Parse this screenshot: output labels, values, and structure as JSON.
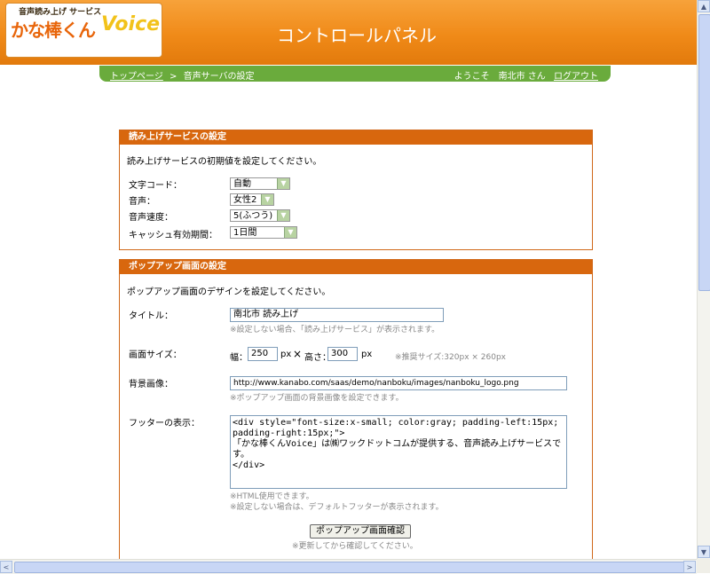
{
  "header": {
    "logo_top": "音声読み上げ サービス",
    "logo_main": "かな棒くん",
    "logo_voice": "Voice",
    "title": "コントロールパネル"
  },
  "nav": {
    "top_link": "トップページ",
    "separator": ">",
    "current": "音声サーバの設定",
    "welcome": "ようこそ　南北市 さん",
    "logout": "ログアウト"
  },
  "reading": {
    "title": "読み上げサービスの設定",
    "desc": "読み上げサービスの初期値を設定してください。",
    "fields": [
      {
        "label": "文字コード：",
        "value": "自動"
      },
      {
        "label": "音声：",
        "value": "女性2"
      },
      {
        "label": "音声速度：",
        "value": "5(ふつう)"
      },
      {
        "label": "キャッシュ有効期間：",
        "value": "1日間"
      }
    ]
  },
  "popup": {
    "title": "ポップアップ画面の設定",
    "desc": "ポップアップ画面のデザインを設定してください。",
    "title_label": "タイトル：",
    "title_value": "南北市 読み上げ",
    "title_note": "※設定しない場合、「読み上げサービス」が表示されます。",
    "size_label": "画面サイズ：",
    "width_label": "幅：",
    "width_value": "250",
    "px1": "px",
    "times": "×",
    "height_label": "高さ：",
    "height_value": "300",
    "px2": "px",
    "size_note": "※推奨サイズ:320px × 260px",
    "bg_label": "背景画像：",
    "bg_value": "http://www.kanabo.com/saas/demo/nanboku/images/nanboku_logo.png",
    "bg_note": "※ポップアップ画面の背景画像を設定できます。",
    "footer_label": "フッターの表示：",
    "footer_value": "<div style=\"font-size:x-small; color:gray; padding-left:15px; padding-right:15px;\">\n「かな棒くんVoice」は㈱ワックドットコムが提供する、音声読み上げサービスです。\n</div>",
    "footer_note1": "※HTML使用できます。",
    "footer_note2": "※設定しない場合は、デフォルトフッターが表示されます。",
    "confirm_button": "ポップアップ画面確認",
    "confirm_note": "※更新してから確認してください。"
  },
  "scrollbar": {
    "up": "▲",
    "down": "▼",
    "left": "<",
    "right": ">"
  }
}
